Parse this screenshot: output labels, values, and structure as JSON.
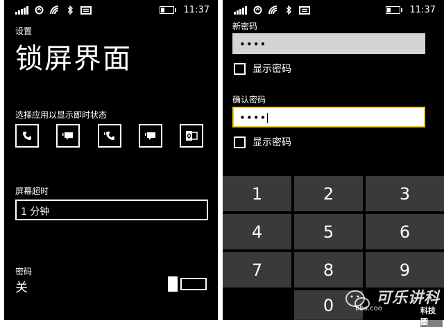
{
  "left_screen": {
    "status": {
      "time": "11:37"
    },
    "settings_label": "设置",
    "page_title": "锁屏界面",
    "app_status_label": "选择应用以显示即时状态",
    "app_tiles": [
      {
        "icon": "phone-icon"
      },
      {
        "icon": "message-icon"
      },
      {
        "icon": "phone-icon"
      },
      {
        "icon": "message-icon"
      },
      {
        "icon": "outlook-icon"
      }
    ],
    "timeout_label": "屏幕超时",
    "timeout_value": "1 分钟",
    "password_label": "密码",
    "password_state": "关"
  },
  "right_screen": {
    "status": {
      "time": "11:37"
    },
    "new_password_label": "新密码",
    "new_password_value": "••••",
    "show_password_label_1": "显示密码",
    "confirm_password_label": "确认密码",
    "confirm_password_value": "••••",
    "show_password_label_2": "显示密码",
    "keys": [
      "1",
      "2",
      "3",
      "4",
      "5",
      "6",
      "7",
      "8",
      "9",
      "0"
    ],
    "colors": {
      "input_gray": "#d4d4d4",
      "input_active": "#ffffff",
      "active_border": "#f0d000",
      "key_bg": "#3a3a3a"
    }
  },
  "watermark": {
    "main": "可乐讲科",
    "sub": "bbs.coo",
    "brand": "科技圈"
  }
}
